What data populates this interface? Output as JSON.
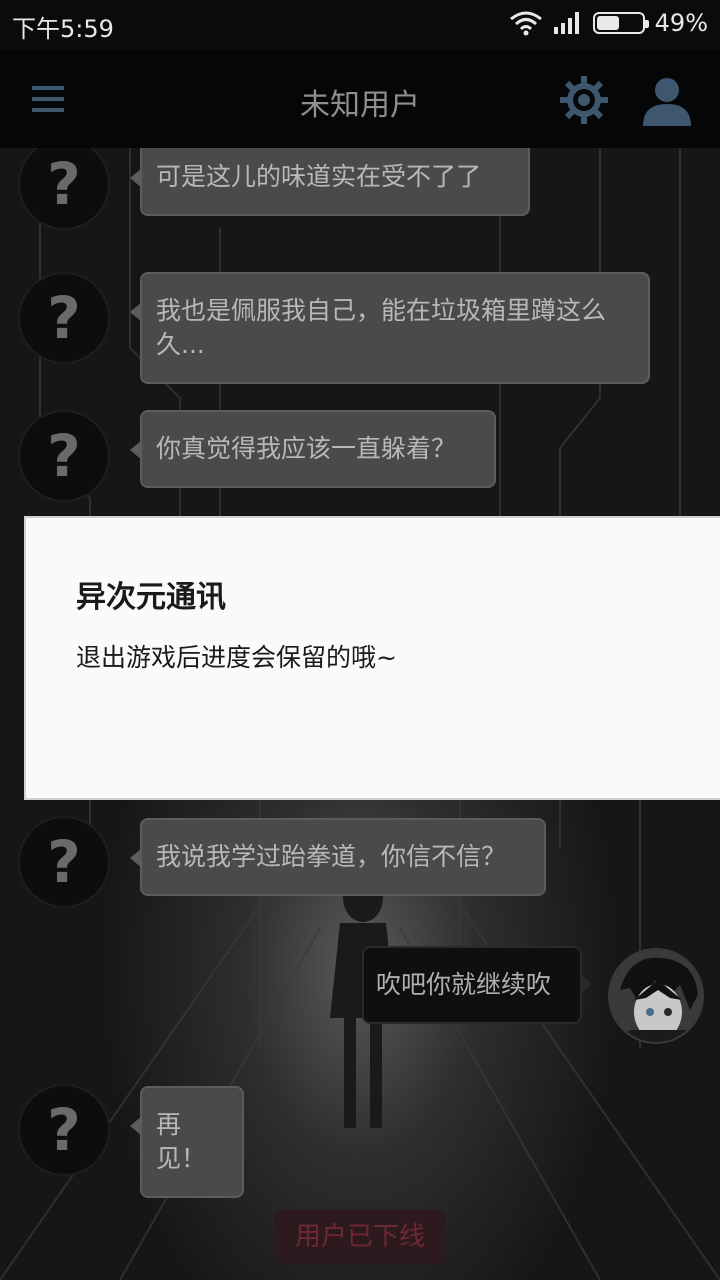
{
  "status_bar": {
    "time": "下午5:59",
    "battery_level": 0.49,
    "battery_text": "49%"
  },
  "top_bar": {
    "title": "未知用户"
  },
  "messages": [
    {
      "from": "unknown",
      "avatar": "?",
      "text": "可是这儿的味道实在受不了了"
    },
    {
      "from": "unknown",
      "avatar": "?",
      "text": "我也是佩服我自己，能在垃圾箱里蹲这么久..."
    },
    {
      "from": "unknown",
      "avatar": "?",
      "text": "你真觉得我应该一直躲着？"
    },
    {
      "from": "unknown",
      "avatar": "?",
      "text": "我说我学过跆拳道，你信不信？"
    },
    {
      "from": "self",
      "text": "吹吧你就继续吹"
    },
    {
      "from": "unknown",
      "avatar": "?",
      "text": "再见！"
    }
  ],
  "offline_status": "用户已下线",
  "dialog": {
    "title": "异次元通讯",
    "message": "退出游戏后进度会保留的哦~"
  },
  "colors": {
    "offline_text": "#6e2834",
    "icon_blue": "#3e566e"
  }
}
